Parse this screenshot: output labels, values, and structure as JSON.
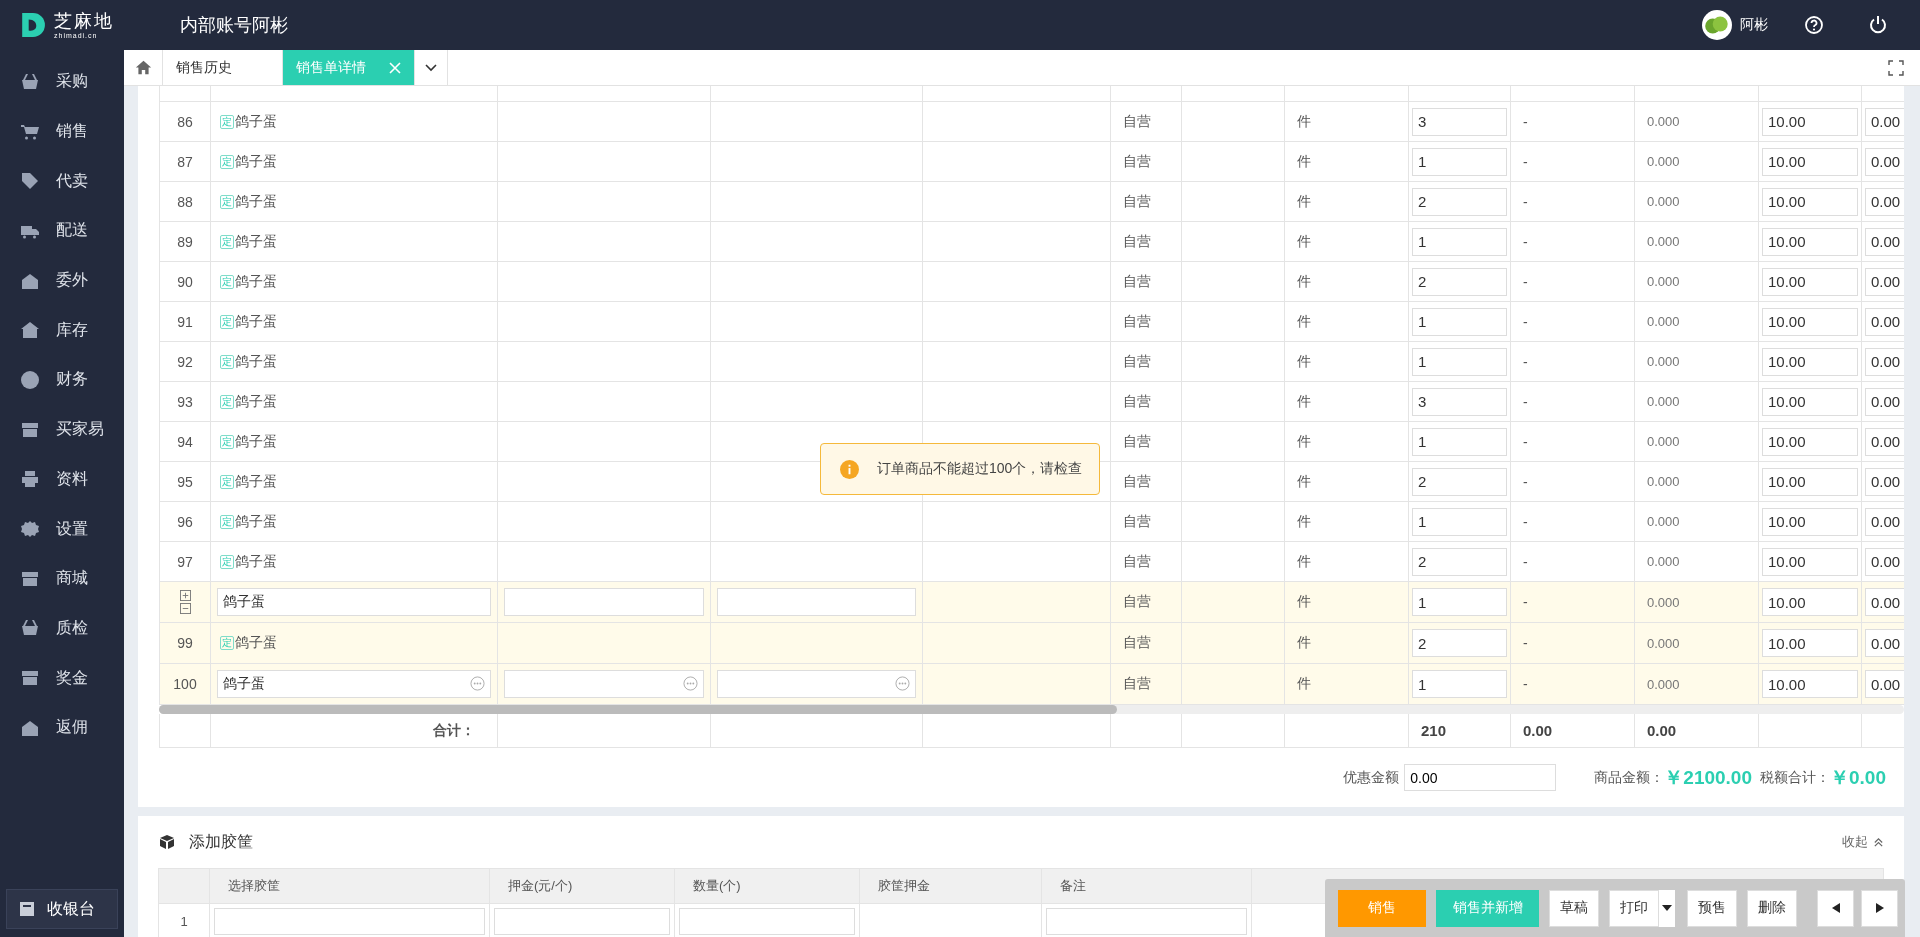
{
  "header": {
    "logo_text": "芝麻地",
    "logo_subtext": "zhimadi.cn",
    "account": "内部账号阿彬",
    "user": "阿彬"
  },
  "sidebar": {
    "items": [
      {
        "label": "采购"
      },
      {
        "label": "销售"
      },
      {
        "label": "代卖"
      },
      {
        "label": "配送"
      },
      {
        "label": "委外"
      },
      {
        "label": "库存"
      },
      {
        "label": "财务"
      },
      {
        "label": "买家易"
      },
      {
        "label": "资料"
      },
      {
        "label": "设置"
      },
      {
        "label": "商城"
      },
      {
        "label": "质检"
      },
      {
        "label": "奖金"
      },
      {
        "label": "返佣"
      }
    ],
    "cashier": "收银台"
  },
  "tabs": [
    {
      "label": "销售历史",
      "selected": false
    },
    {
      "label": "销售单详情",
      "selected": true
    }
  ],
  "goods_table": {
    "rows": [
      {
        "kind": "text",
        "highlighted": false,
        "column_1": "86",
        "tag": "定",
        "column_2": "鸽子蛋",
        "column_6": "自营",
        "column_8": "件",
        "column_9": "3",
        "column_10": "-",
        "column_11": "0.000",
        "column_12": "10.00",
        "column_13": "0.00"
      },
      {
        "kind": "text",
        "highlighted": false,
        "column_1": "87",
        "tag": "定",
        "column_2": "鸽子蛋",
        "column_6": "自营",
        "column_8": "件",
        "column_9": "1",
        "column_10": "-",
        "column_11": "0.000",
        "column_12": "10.00",
        "column_13": "0.00"
      },
      {
        "kind": "text",
        "highlighted": false,
        "column_1": "88",
        "tag": "定",
        "column_2": "鸽子蛋",
        "column_6": "自营",
        "column_8": "件",
        "column_9": "2",
        "column_10": "-",
        "column_11": "0.000",
        "column_12": "10.00",
        "column_13": "0.00"
      },
      {
        "kind": "text",
        "highlighted": false,
        "column_1": "89",
        "tag": "定",
        "column_2": "鸽子蛋",
        "column_6": "自营",
        "column_8": "件",
        "column_9": "1",
        "column_10": "-",
        "column_11": "0.000",
        "column_12": "10.00",
        "column_13": "0.00"
      },
      {
        "kind": "text",
        "highlighted": false,
        "column_1": "90",
        "tag": "定",
        "column_2": "鸽子蛋",
        "column_6": "自营",
        "column_8": "件",
        "column_9": "2",
        "column_10": "-",
        "column_11": "0.000",
        "column_12": "10.00",
        "column_13": "0.00"
      },
      {
        "kind": "text",
        "highlighted": false,
        "column_1": "91",
        "tag": "定",
        "column_2": "鸽子蛋",
        "column_6": "自营",
        "column_8": "件",
        "column_9": "1",
        "column_10": "-",
        "column_11": "0.000",
        "column_12": "10.00",
        "column_13": "0.00"
      },
      {
        "kind": "text",
        "highlighted": false,
        "column_1": "92",
        "tag": "定",
        "column_2": "鸽子蛋",
        "column_6": "自营",
        "column_8": "件",
        "column_9": "1",
        "column_10": "-",
        "column_11": "0.000",
        "column_12": "10.00",
        "column_13": "0.00"
      },
      {
        "kind": "text",
        "highlighted": false,
        "column_1": "93",
        "tag": "定",
        "column_2": "鸽子蛋",
        "column_6": "自营",
        "column_8": "件",
        "column_9": "3",
        "column_10": "-",
        "column_11": "0.000",
        "column_12": "10.00",
        "column_13": "0.00"
      },
      {
        "kind": "text",
        "highlighted": false,
        "column_1": "94",
        "tag": "定",
        "column_2": "鸽子蛋",
        "column_6": "自营",
        "column_8": "件",
        "column_9": "1",
        "column_10": "-",
        "column_11": "0.000",
        "column_12": "10.00",
        "column_13": "0.00"
      },
      {
        "kind": "text",
        "highlighted": false,
        "column_1": "95",
        "tag": "定",
        "column_2": "鸽子蛋",
        "column_6": "自营",
        "column_8": "件",
        "column_9": "2",
        "column_10": "-",
        "column_11": "0.000",
        "column_12": "10.00",
        "column_13": "0.00"
      },
      {
        "kind": "text",
        "highlighted": false,
        "column_1": "96",
        "tag": "定",
        "column_2": "鸽子蛋",
        "column_6": "自营",
        "column_8": "件",
        "column_9": "1",
        "column_10": "-",
        "column_11": "0.000",
        "column_12": "10.00",
        "column_13": "0.00"
      },
      {
        "kind": "text",
        "highlighted": false,
        "column_1": "97",
        "tag": "定",
        "column_2": "鸽子蛋",
        "column_6": "自营",
        "column_8": "件",
        "column_9": "2",
        "column_10": "-",
        "column_11": "0.000",
        "column_12": "10.00",
        "column_13": "0.00"
      },
      {
        "kind": "expand",
        "highlighted": true,
        "column_2": "鸽子蛋",
        "column_6": "自营",
        "column_8": "件",
        "column_9": "1",
        "column_10": "-",
        "column_11": "0.000",
        "column_12": "10.00",
        "column_13": "0.00"
      },
      {
        "kind": "text",
        "highlighted": true,
        "column_1": "99",
        "tag": "定",
        "column_2": "鸽子蛋",
        "column_6": "自营",
        "column_8": "件",
        "column_9": "2",
        "column_10": "-",
        "column_11": "0.000",
        "column_12": "10.00",
        "column_13": "0.00"
      },
      {
        "kind": "picker",
        "highlighted": true,
        "column_1": "100",
        "column_2": "鸽子蛋",
        "column_6": "自营",
        "column_8": "件",
        "column_9": "1",
        "column_10": "-",
        "column_11": "0.000",
        "column_12": "10.00",
        "column_13": "0.00"
      }
    ],
    "totals": {
      "label": "合计：",
      "column_9": "210",
      "column_10": "0.00",
      "column_11": "0.00"
    }
  },
  "summary": {
    "discount_label": "优惠金额",
    "discount_value": "0.00",
    "goods_amount_label": "商品金额：",
    "goods_amount": "￥2100.00",
    "tax_label": "税额合计：",
    "tax_amount": "￥0.00"
  },
  "toast": {
    "message": "订单商品不能超过100个，请检查"
  },
  "crate_section": {
    "title": "添加胶筐",
    "collapse": "收起",
    "columns": [
      "选择胶筐",
      "押金(元/个)",
      "数量(个)",
      "胶筐押金",
      "备注"
    ],
    "rows": [
      {
        "index": "1"
      }
    ]
  },
  "toolbar": {
    "buttons": [
      {
        "label": "销售",
        "kind": "primary"
      },
      {
        "label": "销售并新增",
        "kind": "accent"
      },
      {
        "label": "草稿",
        "kind": "plain"
      },
      {
        "label": "打印",
        "kind": "split"
      },
      {
        "label": "预售",
        "kind": "plain"
      },
      {
        "label": "删除",
        "kind": "plain"
      }
    ]
  }
}
